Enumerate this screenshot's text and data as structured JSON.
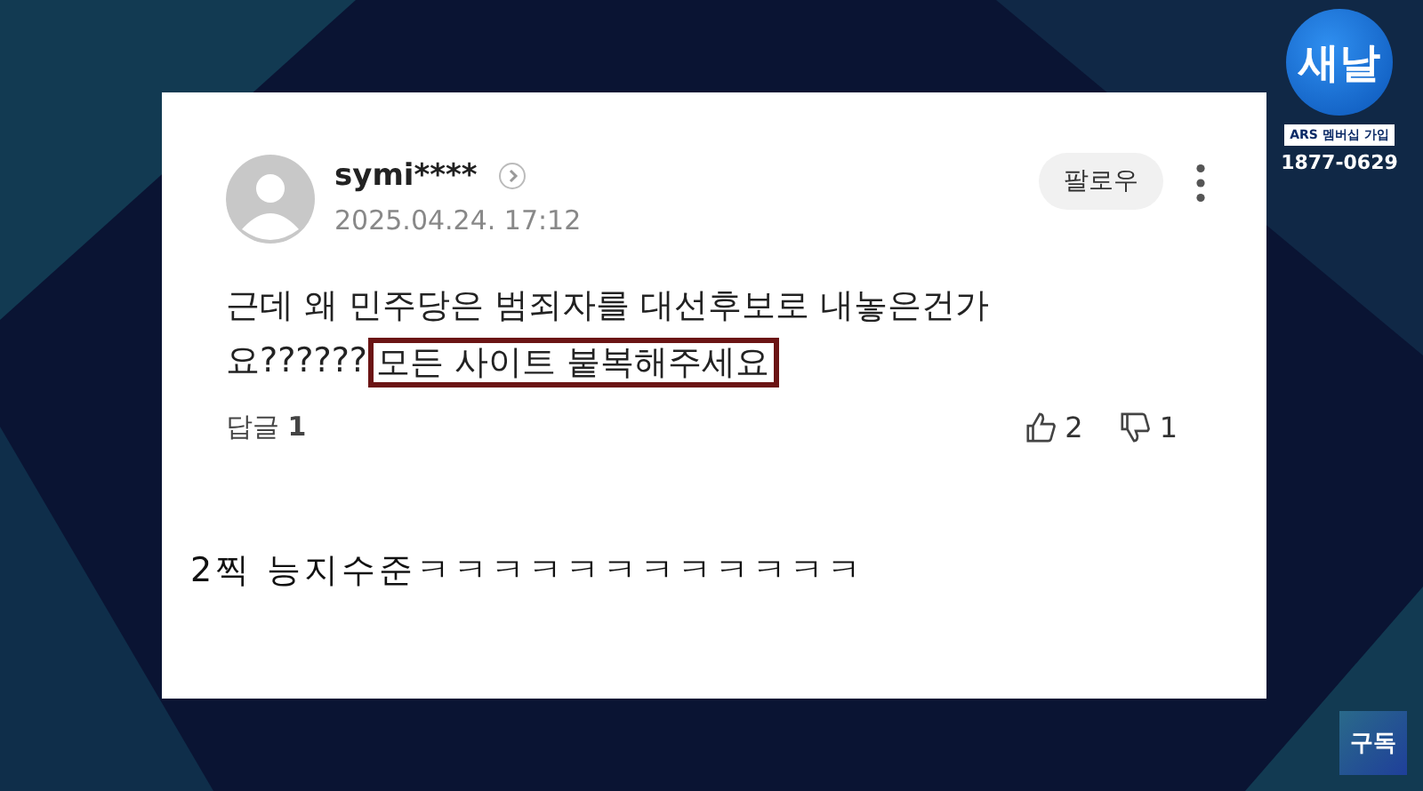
{
  "broadcaster": {
    "logo_text": "새날",
    "ars_label": "ARS 멤버십 가입",
    "phone": "1877-0629"
  },
  "comment": {
    "username": "symi****",
    "date": "2025.04.24. 17:12",
    "follow_button": "팔로우",
    "text_lines": [
      "근데 왜 민주당은 범죄자를 대선후보로 내놓은건가",
      "요??????"
    ],
    "highlighted_text": "모든 사이트 붙복해주세요",
    "replies": "답글 **1**",
    "likes": "2",
    "dislikes": "1"
  },
  "caption": "2찍 능지수준ㅋㅋㅋㅋㅋㅋㅋㅋㅋㅋㅋㅋ",
  "subscribe_button": "구독"
}
